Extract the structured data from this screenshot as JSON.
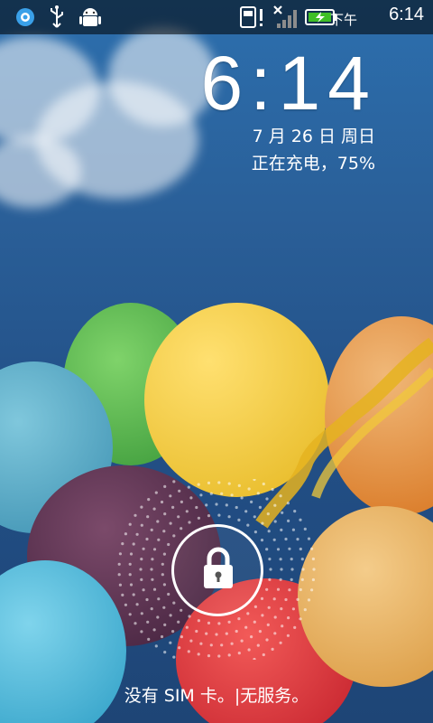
{
  "status_bar": {
    "icons_left": [
      "app-store-icon",
      "usb-icon",
      "android-debug-icon"
    ],
    "icons_right": [
      "sim-card-alert-icon",
      "no-signal-icon",
      "battery-charging-icon"
    ],
    "ampm": "下午",
    "time": "6:14",
    "battery_percent": 75,
    "battery_color": "#3fbf26"
  },
  "lockscreen": {
    "clock": "6:14",
    "date": "7 月 26 日 周日",
    "charging_status": "正在充电，75%",
    "unlock_icon": "lock-icon",
    "sim_message": "没有 SIM 卡。|无服务。"
  }
}
